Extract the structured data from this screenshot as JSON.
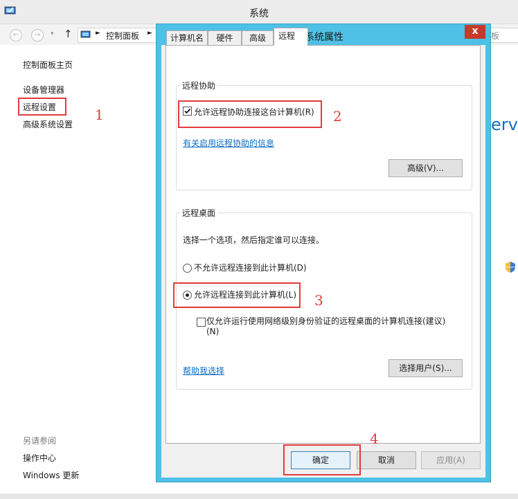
{
  "window": {
    "title": "系统"
  },
  "nav": {
    "breadcrumb": "控制面板",
    "search_placeholder": "板"
  },
  "left_pane": {
    "home_link": "控制面板主页",
    "links": [
      "设备管理器",
      "远程设置",
      "高级系统设置"
    ],
    "see_also_label": "另请参阅",
    "see_also_links": [
      "操作中心",
      "Windows 更新"
    ]
  },
  "right_pane": {
    "partial_text": "erve"
  },
  "dialog": {
    "title": "系统属性",
    "close_glyph": "x",
    "tabs": [
      "计算机名",
      "硬件",
      "高级",
      "远程"
    ],
    "active_tab": "远程",
    "remote_assistance": {
      "group_label": "远程协助",
      "allow_checkbox_label": "允许远程协助连接这台计算机(R)",
      "allow_checked": true,
      "info_link": "有关启用远程协助的信息",
      "advanced_button": "高级(V)..."
    },
    "remote_desktop": {
      "group_label": "远程桌面",
      "instruction": "选择一个选项，然后指定谁可以连接。",
      "option_deny": "不允许远程连接到此计算机(D)",
      "option_allow": "允许远程连接到此计算机(L)",
      "selected_option": "allow",
      "nla_checkbox_line1": "仅允许运行使用网络级别身份验证的远程桌面的计算机连接(建议)",
      "nla_checkbox_line2": "(N)",
      "nla_checked": false,
      "help_link": "帮助我选择",
      "select_users_button": "选择用户(S)..."
    },
    "buttons": {
      "ok": "确定",
      "cancel": "取消",
      "apply": "应用(A)"
    }
  },
  "annotations": [
    "1",
    "2",
    "3",
    "4"
  ],
  "colors": {
    "dialog_frame": "#4fc0e6",
    "close_button": "#c7392b",
    "highlight": "#e23b3b",
    "link": "#0b6bc4"
  }
}
